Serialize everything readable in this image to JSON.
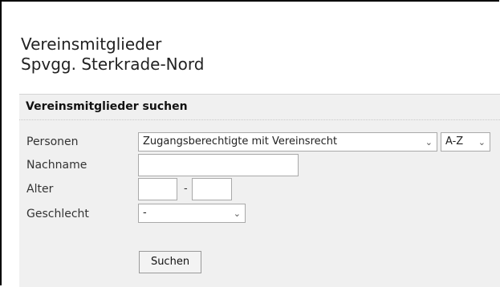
{
  "page": {
    "title_line1": "Vereinsmitglieder",
    "title_line2": "Spvgg. Sterkrade-Nord"
  },
  "search": {
    "header": "Vereinsmitglieder suchen",
    "personen": {
      "label": "Personen",
      "selected": "Zugangsberechtigte mit Vereinsrecht",
      "sort_selected": "A-Z"
    },
    "nachname": {
      "label": "Nachname",
      "value": ""
    },
    "alter": {
      "label": "Alter",
      "from_value": "",
      "separator": "-",
      "to_value": ""
    },
    "geschlecht": {
      "label": "Geschlecht",
      "selected": "-"
    },
    "submit_label": "Suchen"
  },
  "icons": {
    "dropdown": "chevron-down-icon"
  }
}
